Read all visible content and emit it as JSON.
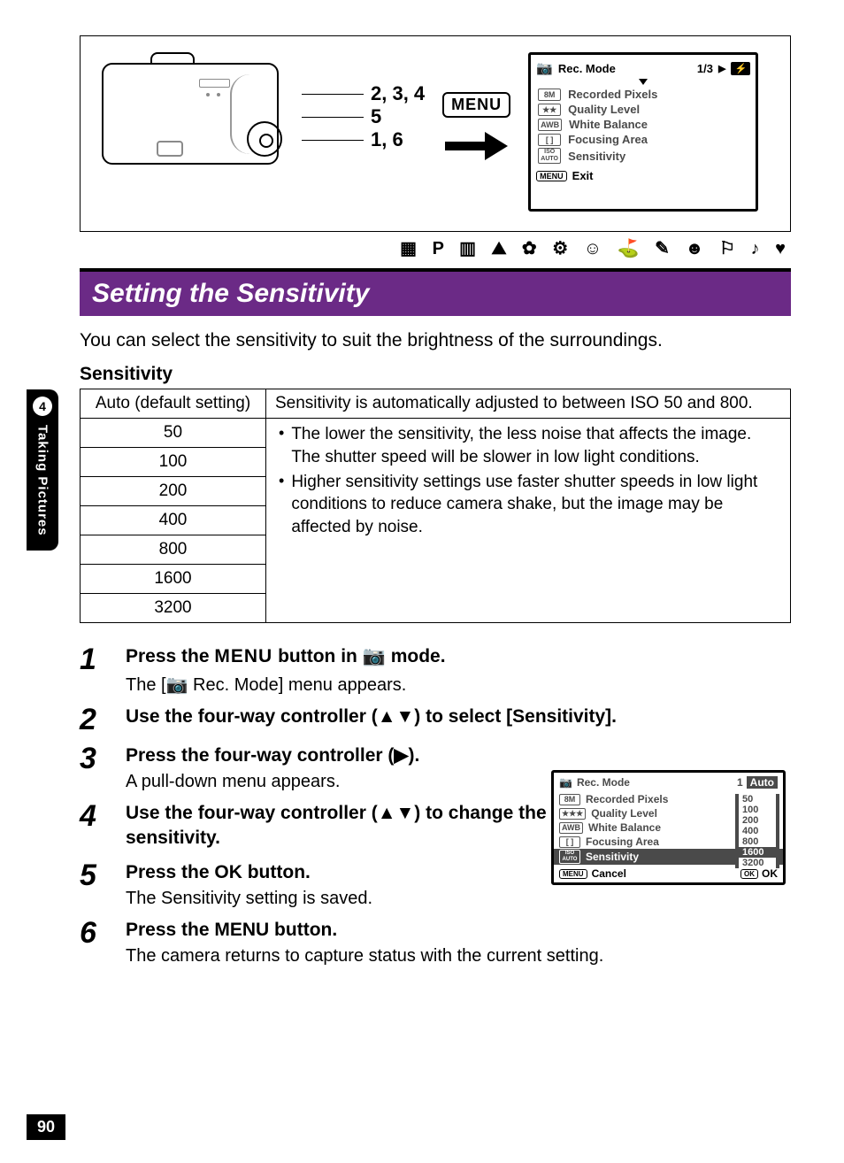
{
  "sidebar": {
    "chapter_number": "4",
    "chapter_title": "Taking Pictures"
  },
  "diagram": {
    "callout_a": "2, 3, 4",
    "callout_b": "5",
    "callout_c": "1, 6",
    "menu_button_label": "MENU",
    "lcd": {
      "title": "Rec. Mode",
      "page": "1/3",
      "flash_icon": "⚡",
      "items": [
        {
          "icon": "8M",
          "label": "Recorded Pixels"
        },
        {
          "icon": "★★",
          "label": "Quality Level"
        },
        {
          "icon": "AWB",
          "label": "White Balance"
        },
        {
          "icon": "[ ]",
          "label": "Focusing Area"
        },
        {
          "icon": "ISO\nAUTO",
          "label": "Sensitivity"
        }
      ],
      "exit_button": "MENU",
      "exit_label": "Exit"
    }
  },
  "mode_icons_strip": "▦ P ▥ ⛰ ✿ ⚙ ☺ ⛳ ✎ ☻ ⚐ ♪ ♥",
  "title": "Setting the Sensitivity",
  "intro": "You can select the sensitivity to suit the brightness of the surroundings.",
  "table_caption": "Sensitivity",
  "table": {
    "auto_label": "Auto (default setting)",
    "auto_desc": "Sensitivity is automatically adjusted to between ISO 50 and 800.",
    "rows": [
      "50",
      "100",
      "200",
      "400",
      "800",
      "1600",
      "3200"
    ],
    "desc_bullets": [
      "The lower the sensitivity, the less noise that affects the image. The shutter speed will be slower in low light conditions.",
      "Higher sensitivity settings use faster shutter speeds in low light conditions to reduce camera shake, but the image may be affected by noise."
    ]
  },
  "steps": [
    {
      "n": "1",
      "heading_before": "Press the ",
      "heading_menu": "MENU",
      "heading_mid": " button in ",
      "heading_icon": "📷",
      "heading_after": " mode.",
      "sub_before": "The [",
      "sub_icon": "📷",
      "sub_after": " Rec. Mode] menu appears."
    },
    {
      "n": "2",
      "heading": "Use the four-way controller (▲▼) to select [Sensitivity]."
    },
    {
      "n": "3",
      "heading": "Press the four-way controller (▶).",
      "sub": "A pull-down menu appears."
    },
    {
      "n": "4",
      "heading": "Use the four-way controller (▲▼) to change the sensitivity."
    },
    {
      "n": "5",
      "heading_before": "Press the ",
      "heading_ok": "OK",
      "heading_after": " button.",
      "sub": "The Sensitivity setting is saved."
    },
    {
      "n": "6",
      "heading": "Press the MENU button.",
      "sub": "The camera returns to capture status with the current setting."
    }
  ],
  "right_lcd": {
    "title": "Rec. Mode",
    "page_num": "1",
    "page_mode": "Auto",
    "items": [
      {
        "icon": "8M",
        "label": "Recorded Pixels"
      },
      {
        "icon": "★★★",
        "label": "Quality Level"
      },
      {
        "icon": "AWB",
        "label": "White Balance"
      },
      {
        "icon": "[ ]",
        "label": "Focusing Area"
      },
      {
        "icon": "ISO\nAUTO",
        "label": "Sensitivity",
        "selected": true
      }
    ],
    "dropdown": [
      "50",
      "100",
      "200",
      "400",
      "800",
      "1600",
      "3200"
    ],
    "dropdown_selected": "1600",
    "cancel_button": "MENU",
    "cancel_label": "Cancel",
    "ok_button": "OK",
    "ok_label": "OK"
  },
  "page_number": "90"
}
